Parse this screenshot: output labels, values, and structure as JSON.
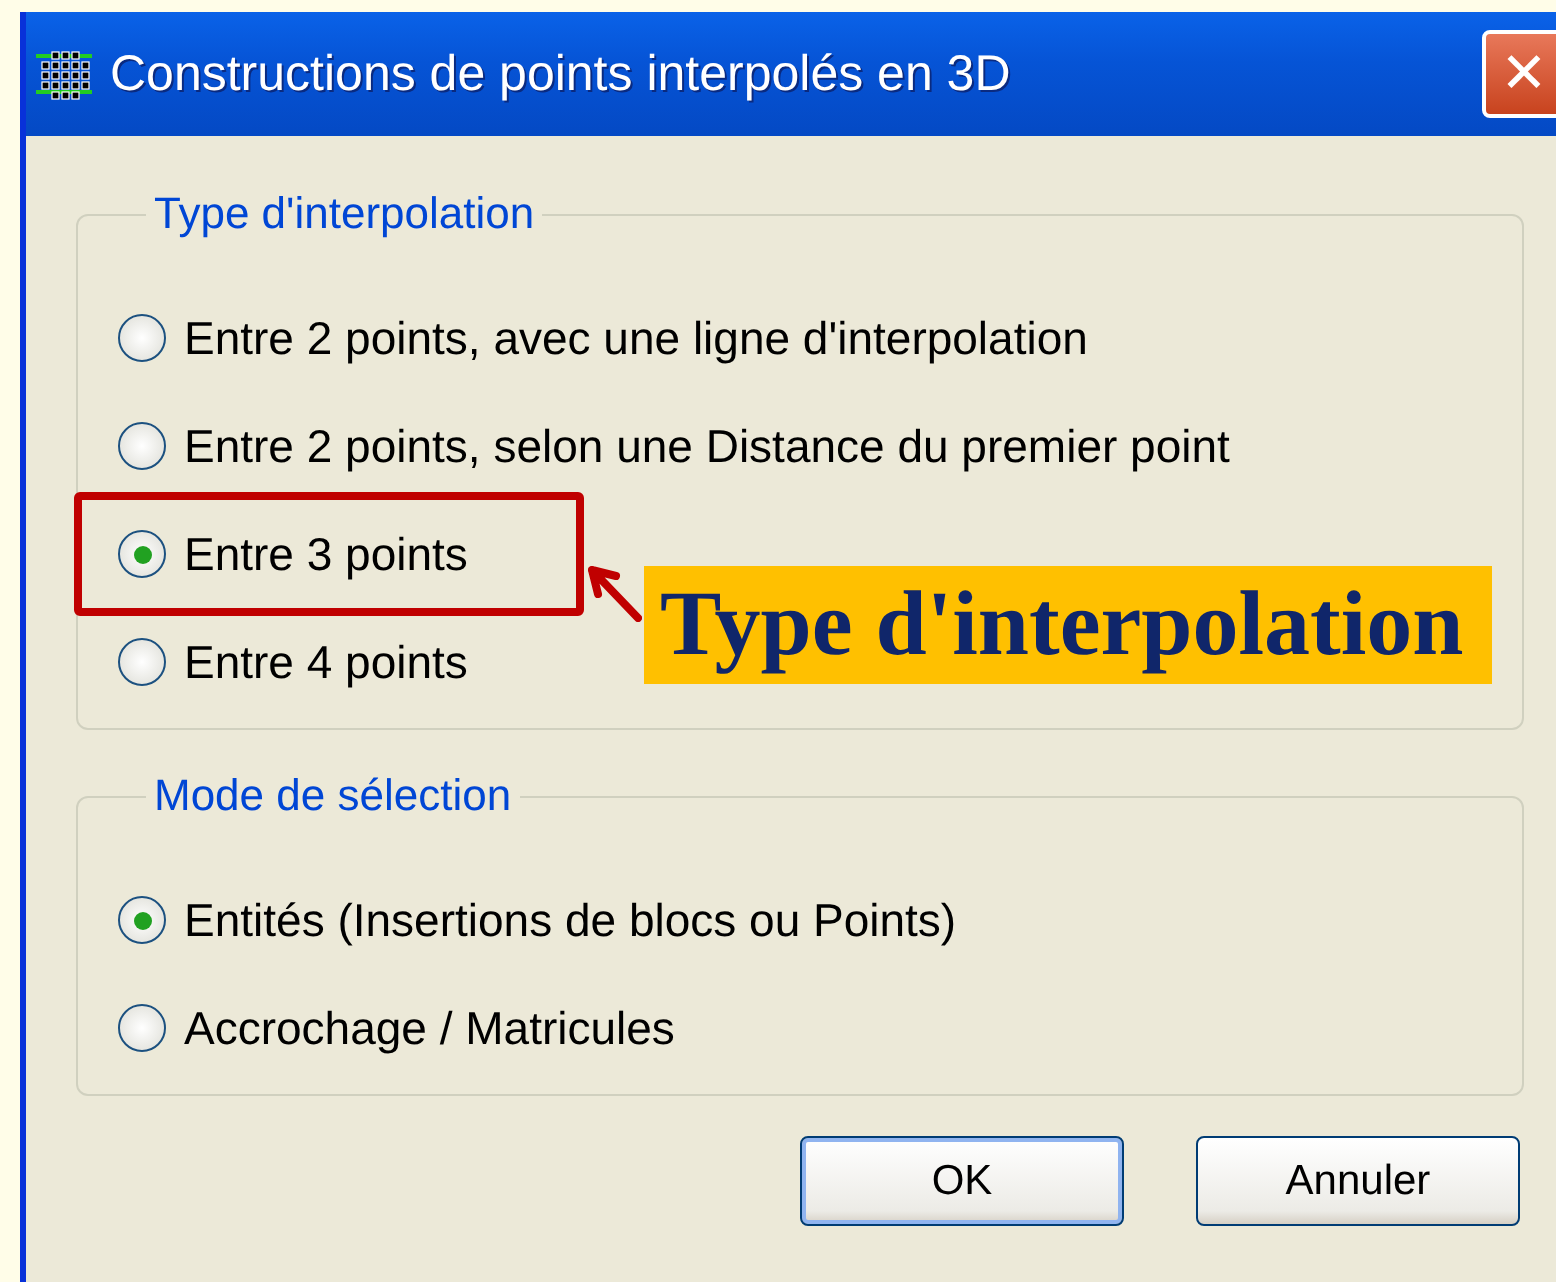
{
  "window": {
    "title": "Constructions de points interpolés en 3D",
    "close": "✕"
  },
  "groups": [
    {
      "legend": "Type d'interpolation",
      "items": [
        {
          "label": "Entre 2 points, avec une ligne d'interpolation",
          "selected": false,
          "highlighted": false
        },
        {
          "label": "Entre 2 points, selon une Distance du premier point",
          "selected": false,
          "highlighted": false
        },
        {
          "label": "Entre 3 points",
          "selected": true,
          "highlighted": true
        },
        {
          "label": "Entre 4 points",
          "selected": false,
          "highlighted": false
        }
      ]
    },
    {
      "legend": "Mode de sélection",
      "items": [
        {
          "label": "Entités (Insertions de blocs ou Points)",
          "selected": true,
          "highlighted": false
        },
        {
          "label": "Accrochage / Matricules",
          "selected": false,
          "highlighted": false
        }
      ]
    }
  ],
  "buttons": [
    {
      "label": "OK",
      "default": true
    },
    {
      "label": "Annuler",
      "default": false
    }
  ],
  "annotation": {
    "label": "Type d'interpolation"
  }
}
